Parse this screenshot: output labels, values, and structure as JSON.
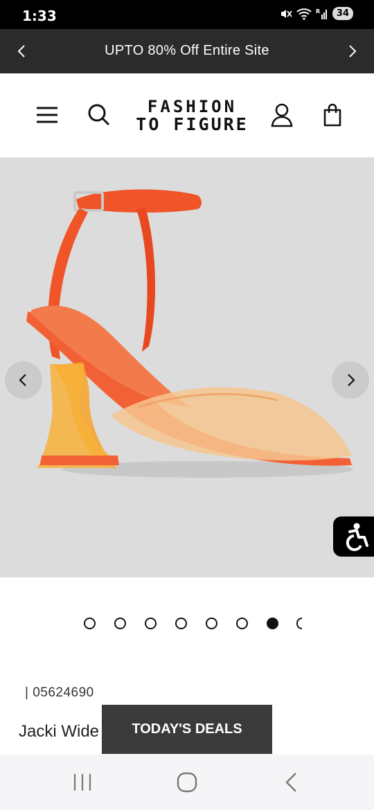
{
  "status_bar": {
    "time": "1:33",
    "battery": "34",
    "icons": [
      "mute-icon",
      "wifi-icon",
      "signal-icon"
    ]
  },
  "promo": {
    "text": "UPTO 80% Off Entire Site"
  },
  "header": {
    "logo_line1": "FASHION",
    "logo_line2": "TO FIGURE",
    "icons": [
      "menu-icon",
      "search-icon",
      "account-icon",
      "bag-icon"
    ]
  },
  "gallery": {
    "background": "#dcdcdc",
    "slide_count_visible": 8,
    "active_slide": 7
  },
  "product": {
    "sku": "| 05624690",
    "title": "Jacki Wide Width Clear Heels"
  },
  "deals": {
    "label": "TODAY'S DEALS"
  },
  "colors": {
    "accent_orange": "#f0552a",
    "dark": "#2b2b2b"
  }
}
